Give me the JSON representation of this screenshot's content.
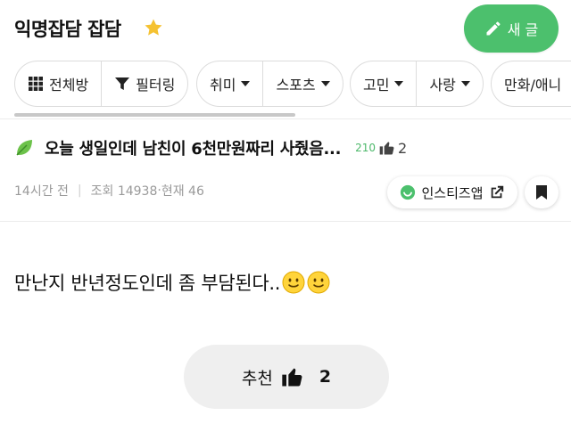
{
  "header": {
    "title": "익명잡담 잡담",
    "write_label": "새 글"
  },
  "filters": {
    "groups": [
      [
        {
          "label": "전체방",
          "icon": "grid-icon"
        },
        {
          "label": "필터링",
          "icon": "filter-icon"
        }
      ],
      [
        {
          "label": "취미",
          "dropdown": true
        },
        {
          "label": "스포츠",
          "dropdown": true
        }
      ],
      [
        {
          "label": "고민",
          "dropdown": true
        },
        {
          "label": "사랑",
          "dropdown": true
        }
      ],
      [
        {
          "label": "만화/애니"
        }
      ]
    ]
  },
  "post": {
    "title": "오늘 생일인데 남친이 6천만원짜리 사줬음...",
    "comment_count": "210",
    "like_count": "2",
    "time": "14시간 전",
    "views": "조회 14938",
    "current": "현재 46",
    "insti_label": "인스티즈앱",
    "body": "만난지 반년정도인데 좀 부담된다..",
    "recommend_label": "추천",
    "recommend_count": "2"
  },
  "colors": {
    "accent": "#4cc06d",
    "star": "#f5c232",
    "comment": "#4cb86a"
  }
}
